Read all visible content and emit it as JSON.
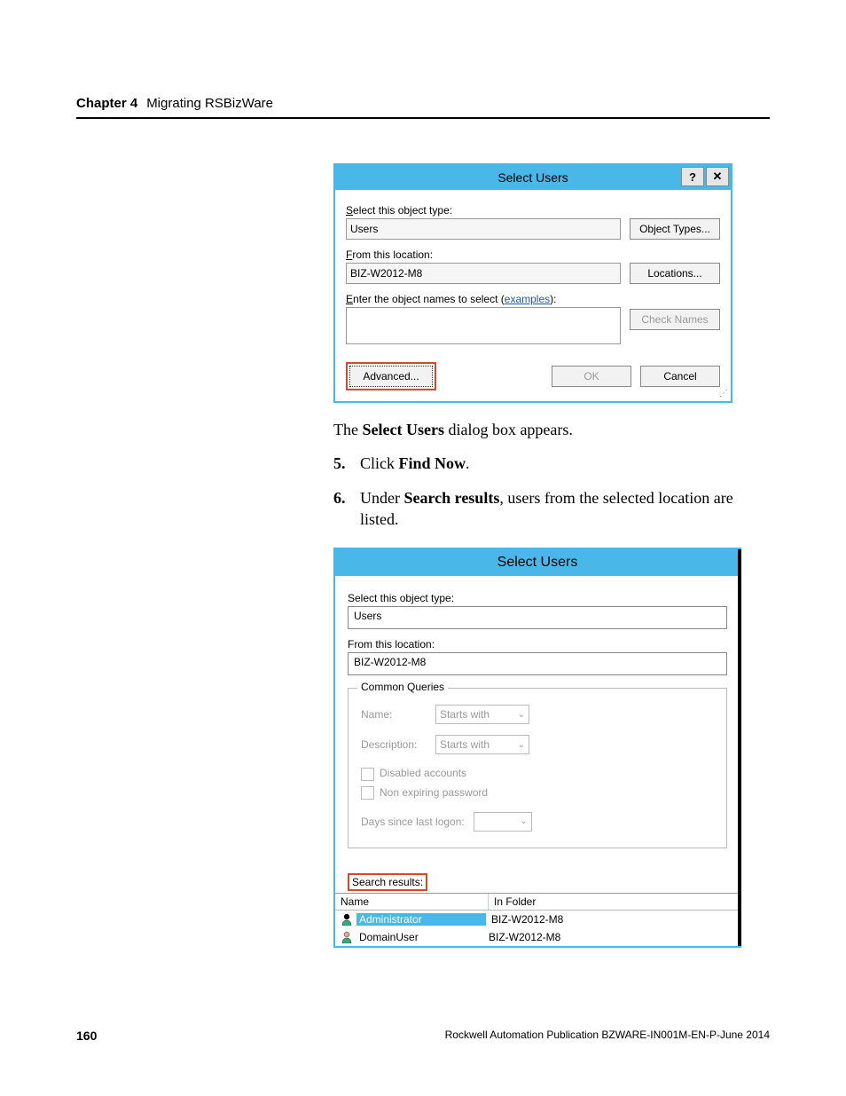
{
  "header": {
    "chapter": "Chapter 4",
    "title": "Migrating RSBizWare"
  },
  "dialog1": {
    "title": "Select Users",
    "label_object_type": "Select this object type:",
    "object_type_value": "Users",
    "btn_object_types": "Object Types...",
    "label_location": "From this location:",
    "location_value": "BIZ-W2012-M8",
    "btn_locations": "Locations...",
    "label_names_prefix": "Enter the object names to select (",
    "label_names_link": "examples",
    "label_names_suffix": "):",
    "btn_check_names": "Check Names",
    "btn_advanced": "Advanced...",
    "btn_ok": "OK",
    "btn_cancel": "Cancel"
  },
  "para1_a": "The ",
  "para1_b": "Select Users",
  "para1_c": " dialog box appears.",
  "step5_num": "5.",
  "step5_a": "Click ",
  "step5_b": "Find Now",
  "step5_c": ".",
  "step6_num": "6.",
  "step6_a": "Under ",
  "step6_b": "Search results",
  "step6_c": ", users from the selected location are listed.",
  "dialog2": {
    "title": "Select Users",
    "label_object_type": "Select this object type:",
    "object_type_value": "Users",
    "label_location": "From this location:",
    "location_value": "BIZ-W2012-M8",
    "group_legend": "Common Queries",
    "name_label": "Name:",
    "name_combo": "Starts with",
    "desc_label": "Description:",
    "desc_combo": "Starts with",
    "cb_disabled": "Disabled accounts",
    "cb_nonexp": "Non expiring password",
    "days_label": "Days since last logon:",
    "results_label": "Search results:",
    "th_name": "Name",
    "th_folder": "In Folder",
    "rows": [
      {
        "name": "Administrator",
        "folder": "BIZ-W2012-M8",
        "selected": true
      },
      {
        "name": "DomainUser",
        "folder": "BIZ-W2012-M8",
        "selected": false
      }
    ]
  },
  "footer": {
    "page": "160",
    "pub": "Rockwell Automation Publication BZWARE-IN001M-EN-P-June 2014"
  }
}
